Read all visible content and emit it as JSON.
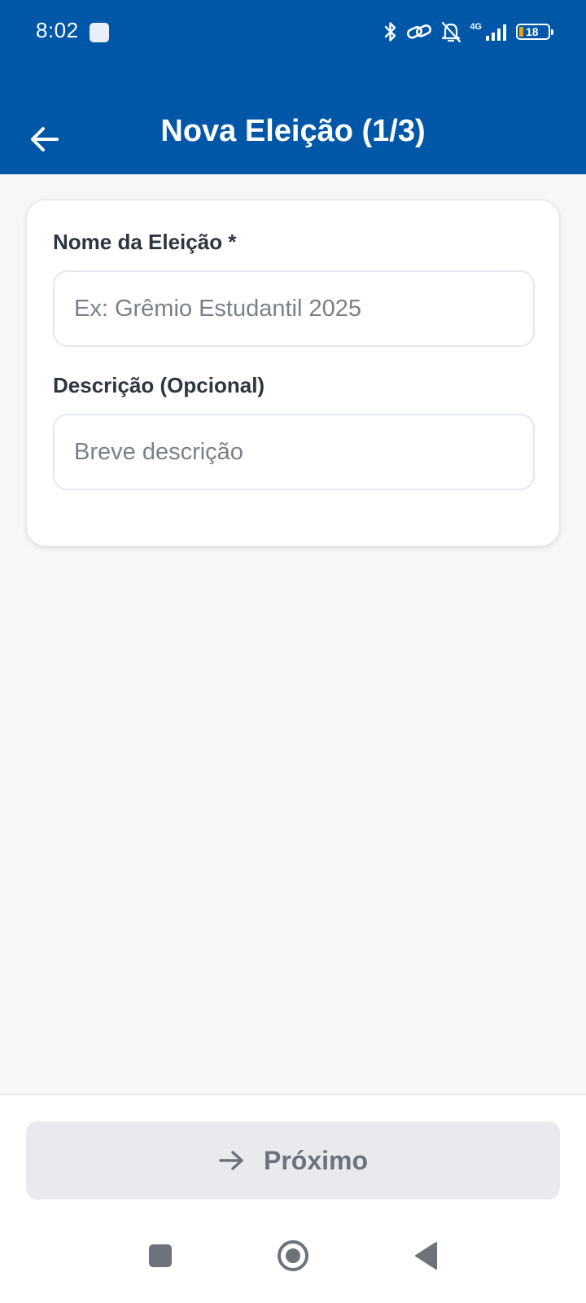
{
  "status_bar": {
    "time": "8:02",
    "network_type": "4G",
    "battery_level": "18",
    "icons": [
      "notification-square-icon",
      "bluetooth-icon",
      "link-icon",
      "bell-off-icon",
      "signal-icon",
      "battery-icon"
    ]
  },
  "app_bar": {
    "title": "Nova Eleição (1/3)",
    "back_icon": "arrow-left-icon"
  },
  "form": {
    "name_label": "Nome da Eleição *",
    "name_placeholder": "Ex: Grêmio Estudantil 2025",
    "name_value": "",
    "description_label": "Descrição (Opcional)",
    "description_placeholder": "Breve descrição",
    "description_value": ""
  },
  "footer": {
    "next_label": "Próximo",
    "next_icon": "arrow-right-icon"
  },
  "nav_bar": {
    "icons": [
      "recents-square-icon",
      "home-circle-icon",
      "back-triangle-icon"
    ]
  },
  "colors": {
    "primary": "#0057a8",
    "background": "#f6f7f9",
    "card": "#ffffff",
    "button_disabled": "#e8eaed",
    "button_text_disabled": "#6d727b"
  }
}
